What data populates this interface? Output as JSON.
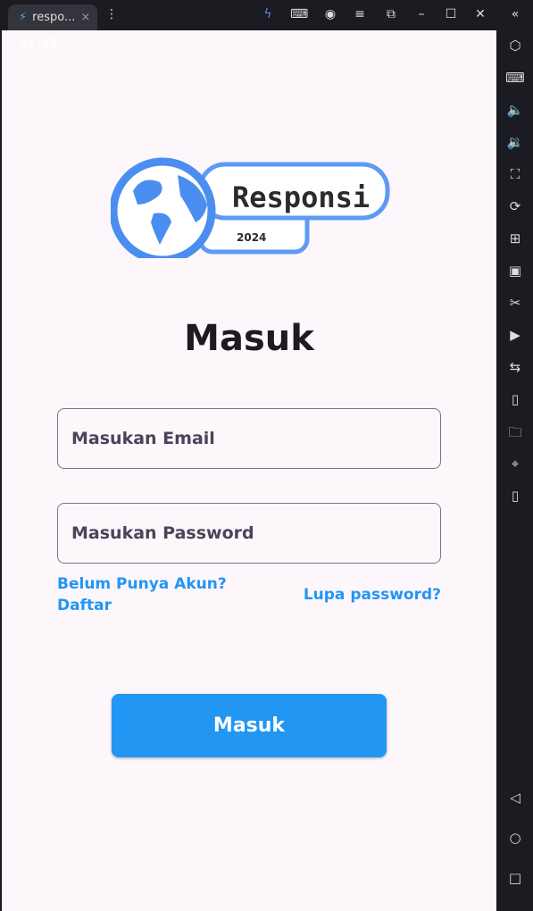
{
  "window": {
    "tab_title": "respo...",
    "tab_close": "×"
  },
  "status_bar": {
    "time": "12:59"
  },
  "logo": {
    "text": "Responsi",
    "year": "2024"
  },
  "page": {
    "title": "Masuk"
  },
  "form": {
    "email_placeholder": "Masukan Email",
    "password_placeholder": "Masukan Password"
  },
  "links": {
    "register_line1": "Belum Punya Akun?",
    "register_line2": "Daftar",
    "forgot": "Lupa password?"
  },
  "submit_label": "Masuk",
  "colors": {
    "accent": "#2196f3",
    "logo_blue": "#4a8ef0",
    "background": "#fdf6fb"
  }
}
